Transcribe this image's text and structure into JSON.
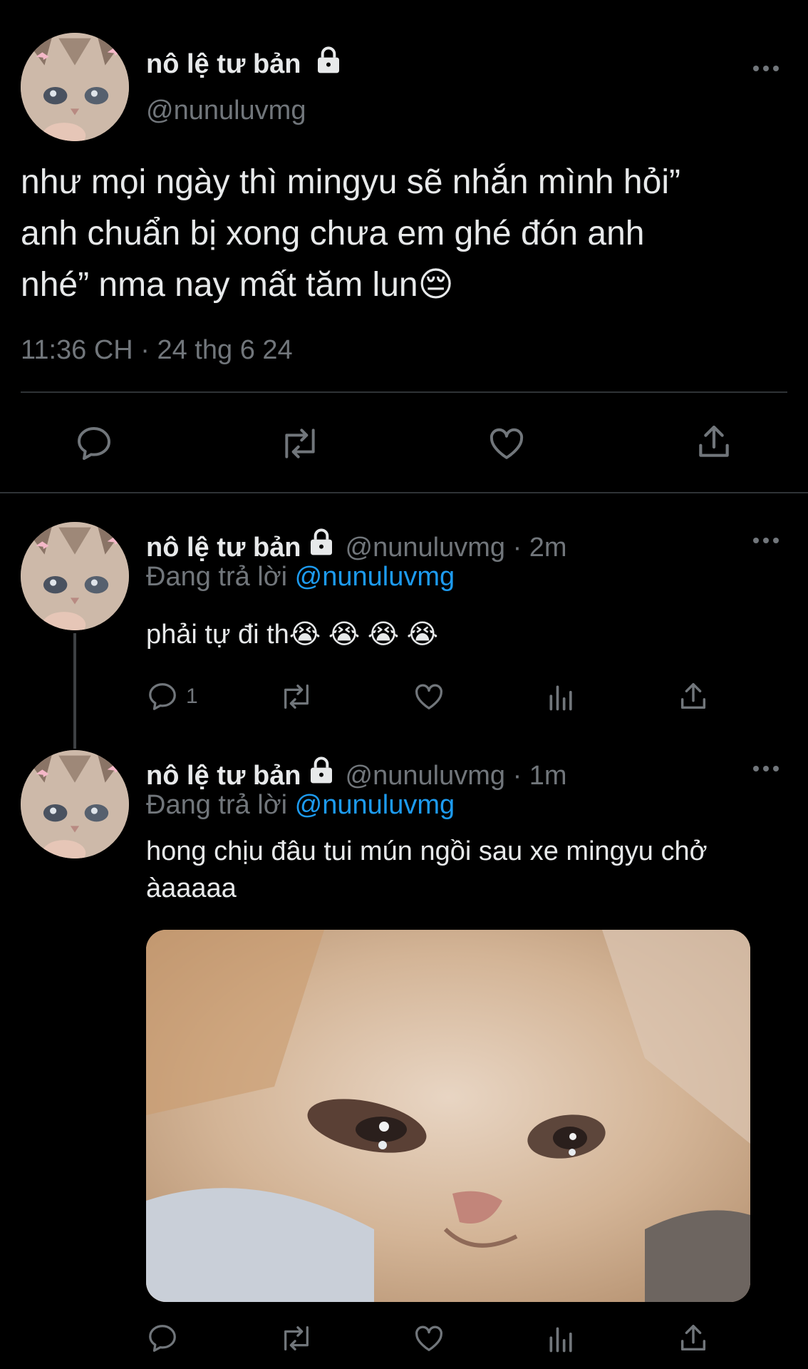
{
  "main_tweet": {
    "author_name": "nô lệ tư bản",
    "handle": "@nunuluvmg",
    "text_line1": "như mọi ngày thì mingyu sẽ nhắn mình hỏi”",
    "text_line2": "anh chuẩn bị xong chưa em ghé đón anh",
    "text_line3": "nhé” nma nay mất tăm lun😔",
    "timestamp": "11:36 CH · 24 thg 6 24"
  },
  "reply1": {
    "author_name": "nô lệ tư bản",
    "handle": "@nunuluvmg · 2m",
    "replying_prefix": "Đang trả lời ",
    "replying_mention": "@nunuluvmg",
    "text": "phải tự đi th😭 😭 😭 😭",
    "reply_count": "1"
  },
  "reply2": {
    "author_name": "nô lệ tư bản",
    "handle": "@nunuluvmg · 1m",
    "replying_prefix": "Đang trả lời ",
    "replying_mention": "@nunuluvmg",
    "text_line1": "hong chịu đâu tui mún ngồi sau xe mingyu chở",
    "text_line2": "àaaaaa"
  },
  "colors": {
    "background": "#000000",
    "text": "#e7e9ea",
    "muted": "#71767b",
    "accent": "#1d9bf0",
    "divider": "#2f3336"
  },
  "icons": [
    "comment-icon",
    "retweet-icon",
    "like-icon",
    "share-icon",
    "views-icon",
    "more-icon",
    "lock-icon"
  ]
}
